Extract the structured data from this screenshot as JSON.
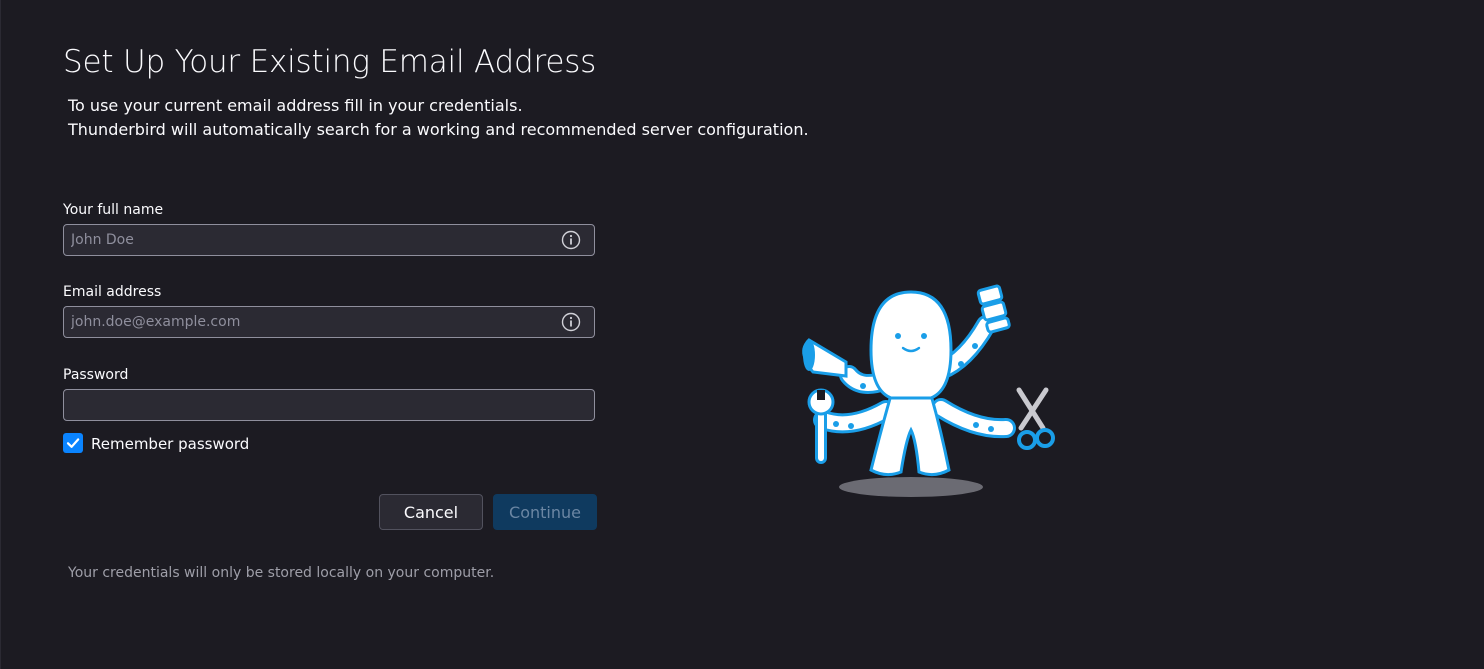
{
  "header": {
    "title": "Set Up Your Existing Email Address",
    "subtitle_line1": "To use your current email address fill in your credentials.",
    "subtitle_line2": "Thunderbird will automatically search for a working and recommended server configuration."
  },
  "form": {
    "full_name": {
      "label": "Your full name",
      "value": "",
      "placeholder": "John Doe",
      "icon": "info-icon"
    },
    "email": {
      "label": "Email address",
      "value": "",
      "placeholder": "john.doe@example.com",
      "icon": "info-icon"
    },
    "password": {
      "label": "Password",
      "value": "",
      "placeholder": ""
    },
    "remember_password": {
      "label": "Remember password",
      "checked": true
    }
  },
  "actions": {
    "cancel_label": "Cancel",
    "continue_label": "Continue",
    "continue_enabled": false
  },
  "footer": {
    "note": "Your credentials will only be stored locally on your computer."
  },
  "illustration": {
    "icon": "octopus-mascot-icon"
  },
  "colors": {
    "background": "#1c1b22",
    "input_background": "#2b2a33",
    "accent": "#0a84ff",
    "continue_disabled": "#0f3a5f",
    "mascot_blue": "#1a9ee8"
  }
}
